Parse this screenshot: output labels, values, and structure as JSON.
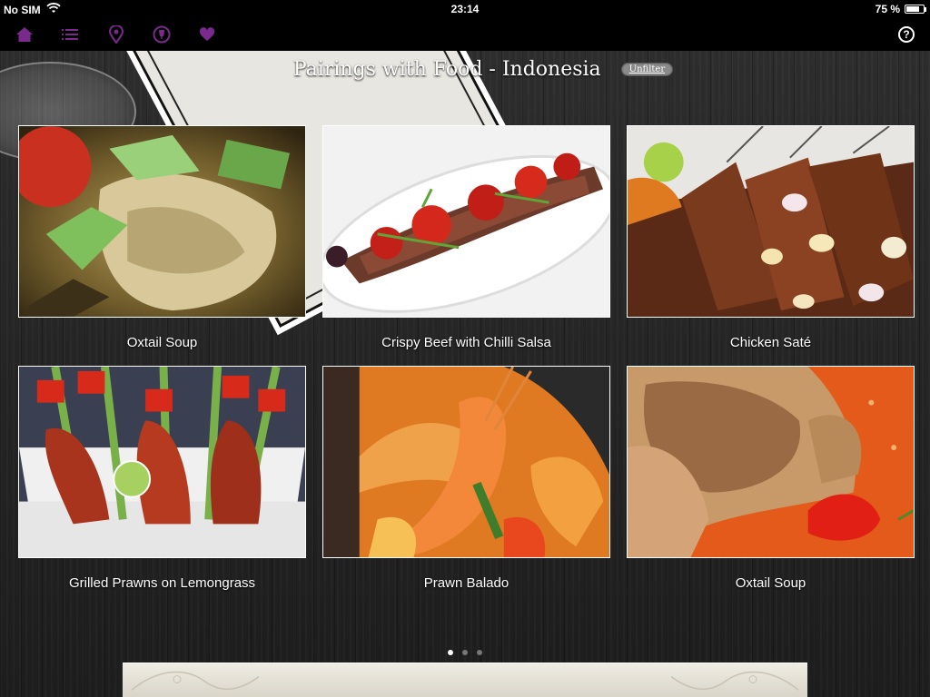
{
  "status_bar": {
    "carrier": "No SIM",
    "time": "23:14",
    "battery": "75 %",
    "battery_level": 0.75
  },
  "toolbar": {
    "icons": [
      "home-icon",
      "list-icon",
      "location-pin-icon",
      "wine-glass-icon",
      "heart-icon"
    ],
    "accent_color": "#7a2a8c",
    "help_label": "?"
  },
  "header": {
    "title": "Pairings with Food - Indonesia",
    "unfilter_label": "Unfilter"
  },
  "dishes": [
    {
      "name": "Oxtail Soup"
    },
    {
      "name": "Crispy Beef with Chilli Salsa"
    },
    {
      "name": "Chicken Saté"
    },
    {
      "name": "Grilled Prawns on Lemongrass"
    },
    {
      "name": "Prawn Balado"
    },
    {
      "name": "Oxtail Soup"
    }
  ],
  "pagination": {
    "pages": 3,
    "current": 1
  }
}
